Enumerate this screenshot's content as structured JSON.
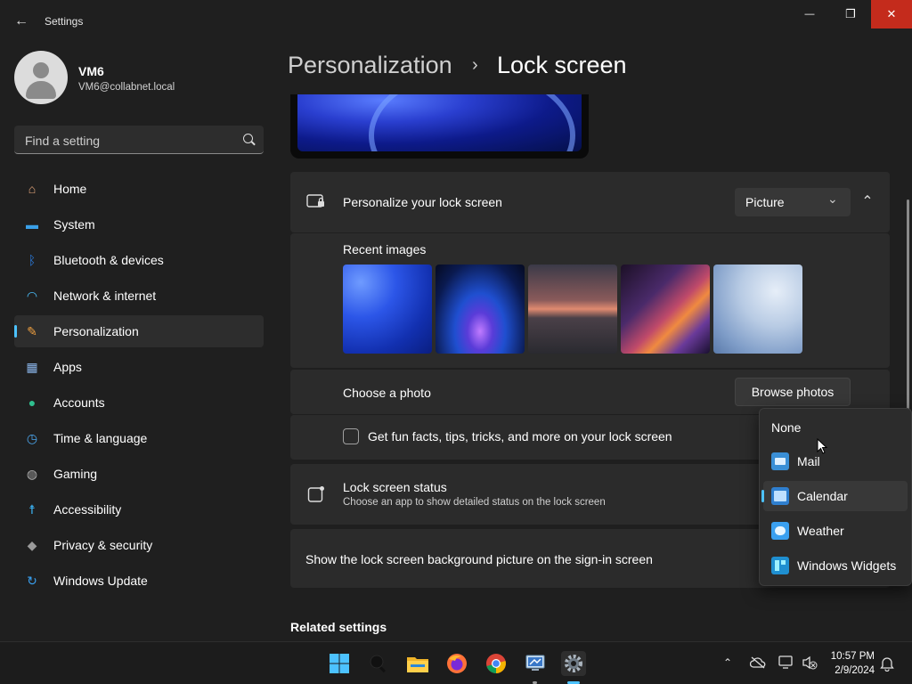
{
  "window": {
    "title": "Settings",
    "back_icon": "arrow-left-icon",
    "minimize_glyph": "—",
    "maximize_glyph": "❐",
    "close_glyph": "✕",
    "back_glyph": "←",
    "close_color": "#c42b1c"
  },
  "user": {
    "name": "VM6",
    "email": "VM6@collabnet.local"
  },
  "search": {
    "placeholder": "Find a setting"
  },
  "sidebar": {
    "items": [
      {
        "label": "Home",
        "icon": "home-icon",
        "glyph": "⌂",
        "color": "#e8a87c"
      },
      {
        "label": "System",
        "icon": "monitor-icon",
        "glyph": "▬",
        "color": "#3aa0e8"
      },
      {
        "label": "Bluetooth & devices",
        "icon": "bluetooth-icon",
        "glyph": "ᛒ",
        "color": "#2b7de0"
      },
      {
        "label": "Network & internet",
        "icon": "wifi-icon",
        "glyph": "◠",
        "color": "#4cc2ff"
      },
      {
        "label": "Personalization",
        "icon": "brush-icon",
        "glyph": "✎",
        "color": "#f0a040"
      },
      {
        "label": "Apps",
        "icon": "apps-icon",
        "glyph": "▦",
        "color": "#8ab4e8"
      },
      {
        "label": "Accounts",
        "icon": "person-icon",
        "glyph": "●",
        "color": "#2fbf8f"
      },
      {
        "label": "Time & language",
        "icon": "clock-globe-icon",
        "glyph": "◷",
        "color": "#4ca8f0"
      },
      {
        "label": "Gaming",
        "icon": "gamepad-icon",
        "glyph": "◍",
        "color": "#b0b0b0"
      },
      {
        "label": "Accessibility",
        "icon": "accessibility-icon",
        "glyph": "☨",
        "color": "#3ab0f0"
      },
      {
        "label": "Privacy & security",
        "icon": "shield-icon",
        "glyph": "◆",
        "color": "#9a9a9a"
      },
      {
        "label": "Windows Update",
        "icon": "update-icon",
        "glyph": "↻",
        "color": "#3aa0f0"
      }
    ],
    "active_index": 4
  },
  "breadcrumb": {
    "parent": "Personalization",
    "separator": "›",
    "current": "Lock screen"
  },
  "personalize": {
    "label": "Personalize your lock screen",
    "icon": "lock-screen-icon",
    "dropdown_value": "Picture",
    "chevron_down": "⌄",
    "chevron_up": "⌃",
    "recent_images_label": "Recent images",
    "choose_photo_label": "Choose a photo",
    "browse_button": "Browse photos",
    "fun_facts_label": "Get fun facts, tips, tricks, and more on your lock screen"
  },
  "status": {
    "label": "Lock screen status",
    "description": "Choose an app to show detailed status on the lock screen",
    "icon": "status-icon"
  },
  "signin": {
    "label": "Show the lock screen background picture on the sign-in screen"
  },
  "related": {
    "label": "Related settings"
  },
  "flyout": {
    "options": [
      {
        "label": "None",
        "icon": ""
      },
      {
        "label": "Mail",
        "icon": "mail-icon"
      },
      {
        "label": "Calendar",
        "icon": "calendar-icon"
      },
      {
        "label": "Weather",
        "icon": "weather-icon"
      },
      {
        "label": "Windows Widgets",
        "icon": "widgets-icon"
      }
    ],
    "selected": "Calendar"
  },
  "taskbar": {
    "apps": [
      "windows-start-icon",
      "search-icon",
      "file-explorer-icon",
      "firefox-icon",
      "chrome-icon",
      "remote-desktop-icon",
      "settings-icon"
    ],
    "time": "10:57 PM",
    "date": "2/9/2024"
  },
  "colors": {
    "accent": "#4cc2ff",
    "background": "#1f1f1f",
    "card": "#2b2b2b"
  }
}
